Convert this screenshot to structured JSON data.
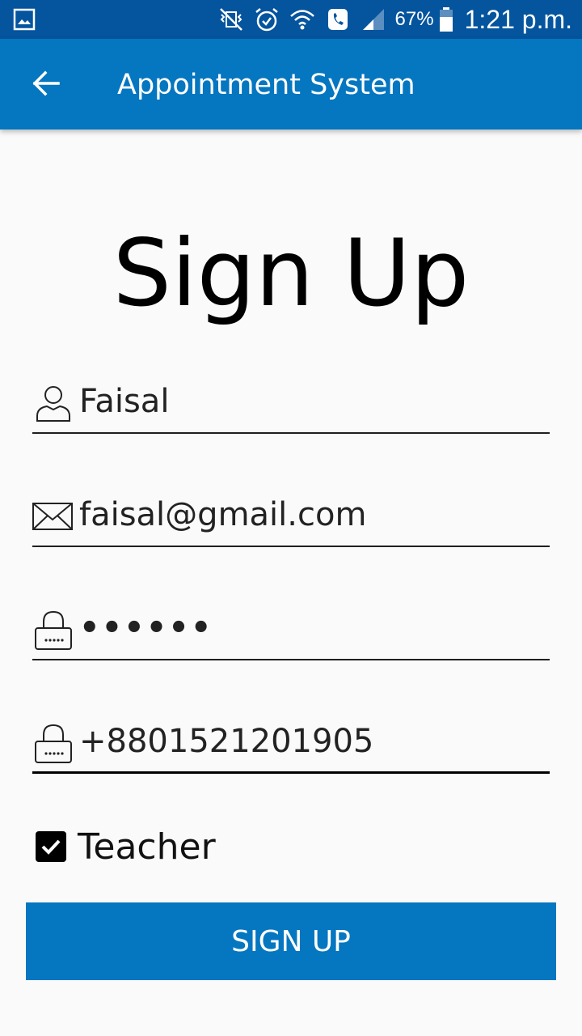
{
  "status_bar": {
    "battery": "67%",
    "time": "1:21 p.m.",
    "icons": [
      "gallery-icon",
      "vibrate-off-icon",
      "alarm-icon",
      "wifi-icon",
      "call-icon",
      "signal-icon",
      "battery-icon"
    ]
  },
  "app_bar": {
    "title": "Appointment System",
    "back_icon": "arrow-back-icon"
  },
  "page": {
    "title": "Sign Up"
  },
  "form": {
    "name": {
      "value": "Faisal",
      "icon": "person-icon"
    },
    "email": {
      "value": "faisal@gmail.com",
      "icon": "envelope-icon"
    },
    "password": {
      "value": "••••••",
      "icon": "lock-icon"
    },
    "phone": {
      "value": "+8801521201905",
      "icon": "lock-icon"
    },
    "teacher_checkbox": {
      "label": "Teacher",
      "checked": true
    },
    "submit_label": "SIGN UP"
  },
  "colors": {
    "status_bar": "#04549e",
    "app_bar": "#0576c0",
    "button": "#0576c0",
    "background": "#fafafa"
  }
}
